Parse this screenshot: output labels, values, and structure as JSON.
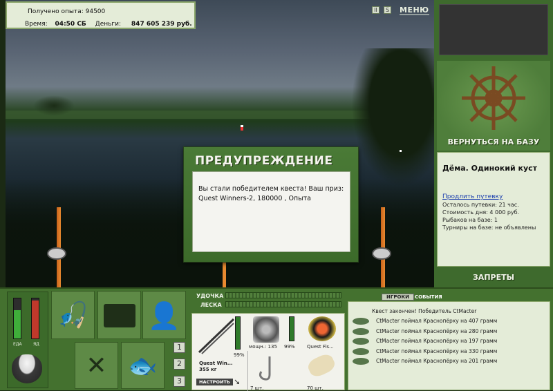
{
  "header": {
    "exp_label": "Получено опыта:",
    "exp_value": "94500",
    "time_label": "Время:",
    "time_value": "04:50 СБ",
    "money_label": "Деньги:",
    "money_value": "847 605 239 руб."
  },
  "top_buttons": {
    "pause": "II",
    "sound": "S",
    "menu": "МЕНЮ"
  },
  "right_panel": {
    "back_to_base": "ВЕРНУТЬСЯ НА БАЗУ",
    "location": "Дёма. Одинокий куст",
    "extend_trip": "Продлить путевку",
    "trip_left": "Осталось путевки: 21 час.",
    "day_cost": "Стоимость дня: 4 000 руб.",
    "anglers": "Рыбаков на базе: 1",
    "tournaments": "Турниры на базе: не объявлены",
    "bans": "ЗАПРЕТЫ"
  },
  "dialog": {
    "title": "ПРЕДУПРЕЖДЕНИЕ",
    "message": "Вы стали победителем квеста! Ваш приз: Quest Winners-2, 180000 , Опыта"
  },
  "bottom": {
    "food_label": "ЕДА",
    "poison_label": "ЯД",
    "food_level": 0.7,
    "poison_level": 0.95,
    "slots": [
      "1",
      "2",
      "3"
    ],
    "rod_label": "УДОЧКА",
    "line_label": "ЛЕСКА",
    "rod_name": "Quest Win...",
    "rod_weight": "355 кг",
    "rod_percent": "99%",
    "setup_button": "НАСТРОИТЬ",
    "reel_power": "мощн.: 135",
    "reel_percent": "99%",
    "line_name": "Quest Fis...",
    "hooks_count": "7 шт.",
    "bait_count": "70 шт."
  },
  "chat": {
    "tabs": [
      "ИГРОКИ",
      "СОБЫТИЯ"
    ],
    "header": "Квест закончен! Победитель CtMacter",
    "events": [
      "CtMacter поймал Краснопёрку на 407 грамм",
      "CtMacter поймал Краснопёрку на 280 грамм",
      "CtMacter поймал Краснопёрку на 197 грамм",
      "CtMacter поймал Краснопёрку на 330 грамм",
      "CtMacter поймал Краснопёрку на 201 грамм"
    ]
  },
  "colors": {
    "panel_green": "#44712f",
    "panel_light": "#e4ecd8",
    "accent_red": "#c0392b"
  }
}
